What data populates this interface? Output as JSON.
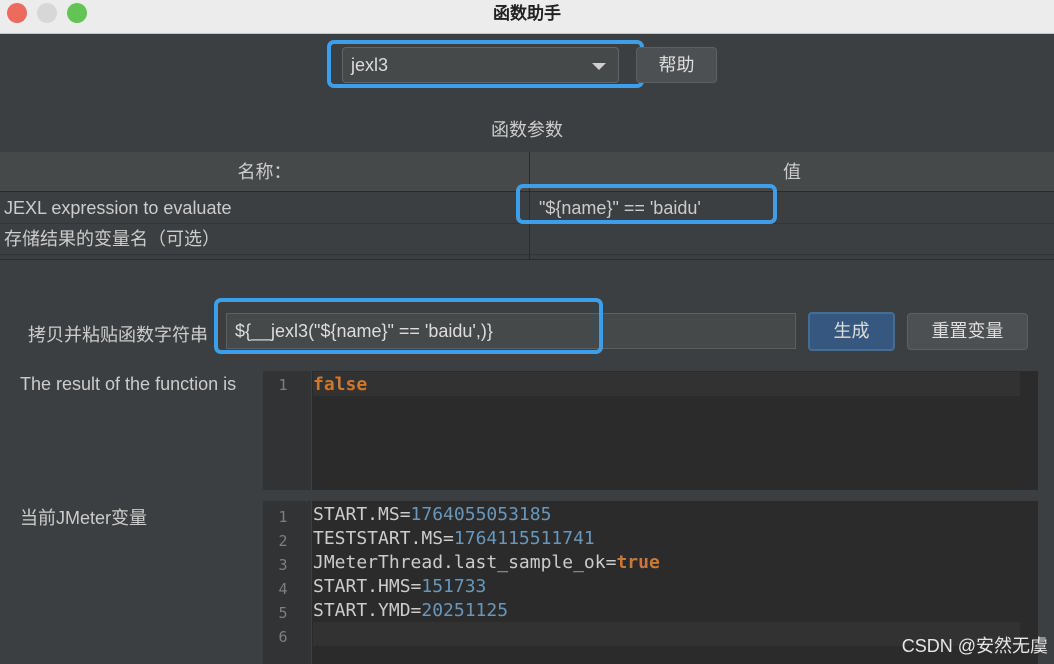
{
  "window": {
    "title": "函数助手",
    "traffic_colors": {
      "close": "#ec6a5e",
      "minimize": "#d7d7d7",
      "maximize": "#61c454"
    }
  },
  "function_select": {
    "value": "jexl3"
  },
  "help_button": {
    "label": "帮助"
  },
  "params": {
    "title": "函数参数",
    "headers": {
      "name": "名称：",
      "value": "值"
    },
    "rows": [
      {
        "name": "JEXL expression to evaluate",
        "value": "\"${name}\" == 'baidu'"
      },
      {
        "name": "存储结果的变量名（可选）",
        "value": ""
      }
    ]
  },
  "copy_paste": {
    "label": "拷贝并粘贴函数字符串",
    "value": "${__jexl3(\"${name}\" == 'baidu',)}"
  },
  "generate_button": {
    "label": "生成"
  },
  "reset_button": {
    "label": "重置变量"
  },
  "result": {
    "label": "The result of the function is",
    "lines": [
      {
        "n": "1",
        "text": "false"
      }
    ]
  },
  "variables": {
    "label": "当前JMeter变量",
    "lines": [
      {
        "n": "1",
        "key": "START.MS=",
        "val": "1764055053185"
      },
      {
        "n": "2",
        "key": "TESTSTART.MS=",
        "val": "1764115511741"
      },
      {
        "n": "3",
        "key": "JMeterThread.last_sample_ok=",
        "val": "true"
      },
      {
        "n": "4",
        "key": "START.HMS=",
        "val": "151733"
      },
      {
        "n": "5",
        "key": "START.YMD=",
        "val": "20251125"
      },
      {
        "n": "6",
        "key": "",
        "val": ""
      }
    ]
  },
  "watermark": "CSDN @安然无虞",
  "highlight_color": "#3d9ee9"
}
